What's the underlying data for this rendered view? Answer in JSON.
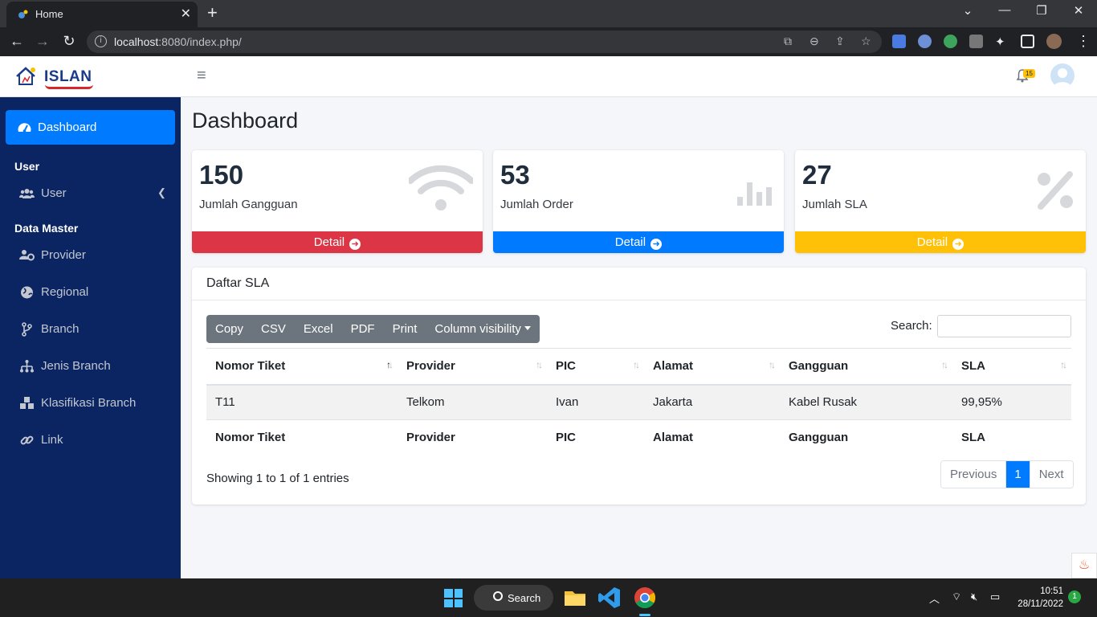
{
  "browser": {
    "tab_title": "Home",
    "url_host": "localhost",
    "url_rest": ":8080/index.php/",
    "tab_close": "✕",
    "new_tab": "+",
    "minimize": "—",
    "restore": "❐",
    "close": "✕"
  },
  "app": {
    "logo_text": "ISLAN",
    "notification_count": "15"
  },
  "sidebar": {
    "active": {
      "label": "Dashboard",
      "icon": "tachometer-icon"
    },
    "sections": [
      {
        "header": "User"
      },
      {
        "header": "Data Master"
      }
    ],
    "items": [
      {
        "label": "User",
        "icon": "users-icon",
        "has_submenu": true
      },
      {
        "label": "Provider",
        "icon": "users-cog-icon"
      },
      {
        "label": "Regional",
        "icon": "globe-icon"
      },
      {
        "label": "Branch",
        "icon": "code-branch-icon"
      },
      {
        "label": "Jenis Branch",
        "icon": "sitemap-icon"
      },
      {
        "label": "Klasifikasi Branch",
        "icon": "cubes-icon"
      },
      {
        "label": "Link",
        "icon": "link-icon"
      }
    ]
  },
  "dashboard": {
    "title": "Dashboard",
    "boxes": [
      {
        "value": "150",
        "label": "Jumlah Gangguan",
        "footer": "Detail",
        "color": "#dc3545",
        "icon": "wifi-icon"
      },
      {
        "value": "53",
        "label": "Jumlah Order",
        "footer": "Detail",
        "color": "#007bff",
        "icon": "chart-bar-icon"
      },
      {
        "value": "27",
        "label": "Jumlah SLA",
        "footer": "Detail",
        "color": "#ffc107",
        "icon": "percent-icon"
      }
    ]
  },
  "sla_table": {
    "title": "Daftar SLA",
    "buttons": [
      "Copy",
      "CSV",
      "Excel",
      "PDF",
      "Print",
      "Column visibility"
    ],
    "search_label": "Search:",
    "search_value": "",
    "columns": [
      "Nomor Tiket",
      "Provider",
      "PIC",
      "Alamat",
      "Gangguan",
      "SLA"
    ],
    "rows": [
      [
        "T11",
        "Telkom",
        "Ivan",
        "Jakarta",
        "Kabel Rusak",
        "99,95%"
      ]
    ],
    "info": "Showing 1 to 1 of 1 entries",
    "pagination": {
      "previous": "Previous",
      "current": "1",
      "next": "Next"
    }
  },
  "taskbar": {
    "search_label": "Search",
    "time": "10:51",
    "date": "28/11/2022",
    "notifications": "1"
  }
}
